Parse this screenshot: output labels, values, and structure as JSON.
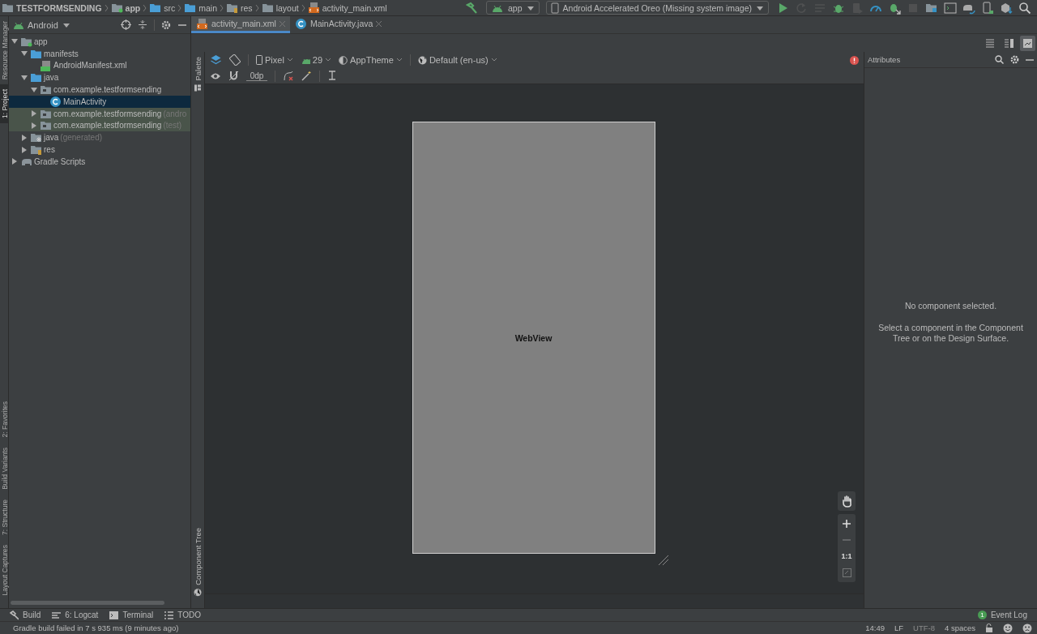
{
  "navbar": {
    "breadcrumbs": [
      {
        "label": "TESTFORMSENDING",
        "kind": "project"
      },
      {
        "label": "app",
        "kind": "module"
      },
      {
        "label": "src",
        "kind": "folder"
      },
      {
        "label": "main",
        "kind": "folder"
      },
      {
        "label": "res",
        "kind": "res"
      },
      {
        "label": "layout",
        "kind": "layout-folder"
      },
      {
        "label": "activity_main.xml",
        "kind": "layout"
      }
    ],
    "run_config": "app",
    "device": "Android Accelerated Oreo (Missing system image)",
    "actions": [
      {
        "kind": "run",
        "disabled": false
      },
      {
        "kind": "rerun",
        "disabled": true
      },
      {
        "kind": "apply",
        "disabled": true
      },
      {
        "kind": "debug",
        "disabled": false
      },
      {
        "kind": "attach",
        "disabled": true
      },
      {
        "kind": "profile",
        "disabled": false
      },
      {
        "kind": "debug-attach",
        "disabled": false
      },
      {
        "kind": "stop",
        "disabled": true
      },
      {
        "kind": "structure",
        "disabled": false
      },
      {
        "kind": "terminal",
        "disabled": false
      },
      {
        "kind": "sync",
        "disabled": false
      },
      {
        "kind": "avd",
        "disabled": false
      },
      {
        "kind": "sdk",
        "disabled": false
      },
      {
        "kind": "search",
        "disabled": false
      }
    ]
  },
  "left_tool_strip": {
    "top": [
      {
        "label": "Resource Manager",
        "selected": false
      },
      {
        "label": "1: Project",
        "selected": true
      }
    ],
    "bottom": [
      {
        "label": "2: Favorites",
        "selected": false
      },
      {
        "label": "Build Variants",
        "selected": false
      },
      {
        "label": "7: Structure",
        "selected": false
      },
      {
        "label": "Layout Captures",
        "selected": false
      }
    ]
  },
  "project": {
    "view": "Android",
    "tree": [
      {
        "label": "app",
        "kind": "module",
        "expanded": true,
        "selected": false,
        "test": false,
        "children": [
          {
            "label": "manifests",
            "kind": "folder",
            "expanded": true,
            "selected": false,
            "test": false,
            "children": [
              {
                "label": "AndroidManifest.xml",
                "kind": "manifest",
                "selected": false,
                "test": false
              }
            ]
          },
          {
            "label": "java",
            "kind": "folder",
            "expanded": true,
            "selected": false,
            "test": false,
            "children": [
              {
                "label": "com.example.testformsending",
                "kind": "package",
                "expanded": true,
                "selected": false,
                "test": false,
                "children": [
                  {
                    "label": "MainActivity",
                    "kind": "class",
                    "selected": true,
                    "test": false
                  }
                ]
              },
              {
                "label": "com.example.testformsending",
                "suffix": "(andro",
                "kind": "package",
                "expanded": false,
                "selected": false,
                "test": true
              },
              {
                "label": "com.example.testformsending",
                "suffix": "(test)",
                "kind": "package",
                "expanded": false,
                "selected": false,
                "test": true
              }
            ]
          },
          {
            "label": "java",
            "suffix": "(generated)",
            "kind": "generated",
            "expanded": false,
            "selected": false,
            "test": false
          },
          {
            "label": "res",
            "kind": "res",
            "expanded": false,
            "selected": false,
            "test": false
          }
        ]
      },
      {
        "label": "Gradle Scripts",
        "kind": "gradle",
        "expanded": false,
        "selected": false,
        "test": false
      }
    ]
  },
  "editor": {
    "tabs": [
      {
        "label": "activity_main.xml",
        "kind": "layout",
        "selected": true
      },
      {
        "label": "MainActivity.java",
        "kind": "class",
        "selected": false
      }
    ],
    "view_modes": [
      {
        "kind": "code",
        "selected": false
      },
      {
        "kind": "split",
        "selected": false
      },
      {
        "kind": "design",
        "selected": true
      }
    ],
    "palette_label": "Palette",
    "component_tree_label": "Component Tree",
    "design_toolbar": {
      "device": "Pixel",
      "api": "29",
      "theme": "AppTheme",
      "locale": "Default (en-us)",
      "margin": "0dp",
      "has_error": true
    },
    "canvas": {
      "component": "WebView"
    },
    "zoom_controls": [
      {
        "kind": "pan",
        "disabled": false
      },
      {
        "kind": "zoom-in",
        "disabled": false
      },
      {
        "kind": "zoom-out",
        "disabled": true
      },
      {
        "kind": "actual-size",
        "label": "1:1",
        "disabled": false
      },
      {
        "kind": "fit",
        "disabled": true
      }
    ]
  },
  "attributes": {
    "title": "Attributes",
    "empty_title": "No component selected.",
    "empty_hint": "Select a component in the Component Tree or on the Design Surface."
  },
  "tool_windows": [
    {
      "label": "Build",
      "kind": "build"
    },
    {
      "label": "6: Logcat",
      "kind": "logcat"
    },
    {
      "label": "Terminal",
      "kind": "terminal"
    },
    {
      "label": "TODO",
      "kind": "todo"
    }
  ],
  "event_log": {
    "count": "1",
    "label": "Event Log"
  },
  "status_bar": {
    "message": "Gradle build failed in 7 s 935 ms (9 minutes ago)",
    "items": [
      {
        "label": "14:49",
        "disabled": false
      },
      {
        "label": "LF",
        "disabled": false
      },
      {
        "label": "UTF-8",
        "disabled": true
      },
      {
        "label": "4 spaces",
        "disabled": false
      }
    ]
  }
}
